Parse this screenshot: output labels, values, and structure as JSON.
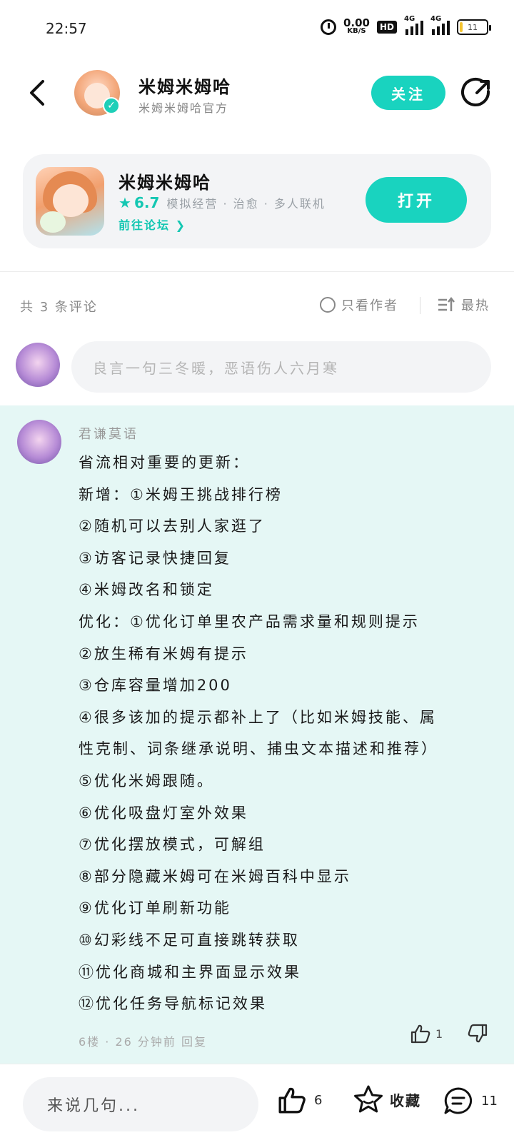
{
  "status_bar": {
    "time": "22:57",
    "net_speed_value": "0.00",
    "net_speed_unit": "KB/S",
    "hd_badge": "HD",
    "signal_1_label": "4G",
    "signal_2_label": "4G",
    "battery_label": "11",
    "battery_level_fraction": 0.11
  },
  "header": {
    "author_name": "米姆米姆哈",
    "author_subtitle": "米姆米姆哈官方",
    "follow_label": "关注"
  },
  "app_card": {
    "title": "米姆米姆哈",
    "rating": "6.7",
    "tags": "模拟经营 · 治愈 · 多人联机",
    "forum_link": "前往论坛",
    "open_label": "打开"
  },
  "comments_header": {
    "count_text": "共 3 条评论",
    "only_author_label": "只看作者",
    "sort_label": "最热"
  },
  "compose": {
    "placeholder": "良言一句三冬暖，恶语伤人六月寒"
  },
  "comment": {
    "username": "君谦莫语",
    "lines": [
      "省流相对重要的更新：",
      "新增：①米姆王挑战排行榜",
      "②随机可以去别人家逛了",
      "③访客记录快捷回复",
      "④米姆改名和锁定",
      "优化：①优化订单里农产品需求量和规则提示",
      "②放生稀有米姆有提示",
      "③仓库容量增加200",
      "④很多该加的提示都补上了（比如米姆技能、属",
      "性克制、词条继承说明、捕虫文本描述和推荐）",
      "⑤优化米姆跟随。",
      "⑥优化吸盘灯室外效果",
      "⑦优化摆放模式，可解组",
      "⑧部分隐藏米姆可在米姆百科中显示",
      "⑨优化订单刷新功能",
      "⑩幻彩线不足可直接跳转获取",
      "⑪优化商城和主界面显示效果",
      "⑫优化任务导航标记效果"
    ],
    "meta": "6楼 · 26 分钟前  回复",
    "like_count": "1"
  },
  "bottom_bar": {
    "input_placeholder": "来说几句...",
    "like_count": "6",
    "favorite_label": "收藏",
    "comment_count": "11"
  },
  "colors": {
    "accent": "#19d3bf",
    "comment_bg": "#e5f7f5",
    "card_bg": "#f3f4f6"
  }
}
